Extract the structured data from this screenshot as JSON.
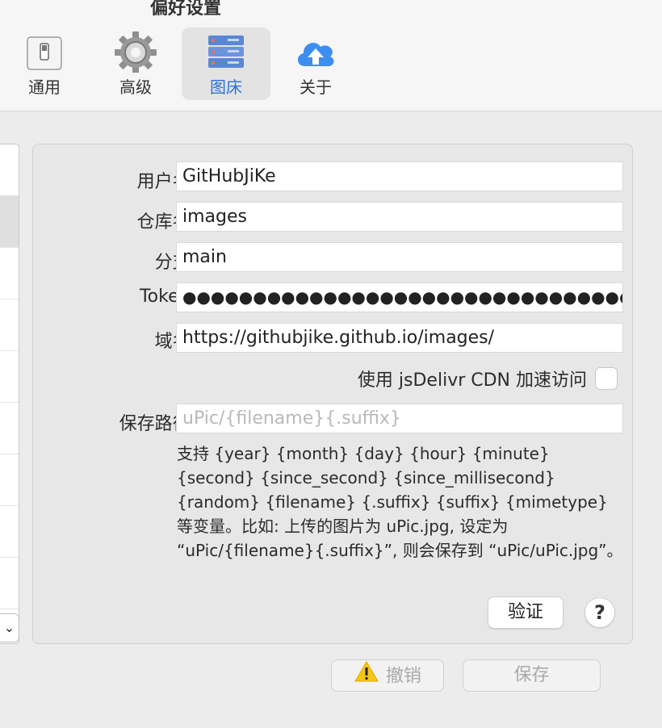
{
  "window": {
    "title": "偏好设置"
  },
  "toolbar": {
    "items": [
      {
        "label": "通用",
        "icon": "switch-icon"
      },
      {
        "label": "高级",
        "icon": "gear-icon"
      },
      {
        "label": "图床",
        "icon": "server-icon",
        "active": true
      },
      {
        "label": "关于",
        "icon": "cloud-upload-icon"
      }
    ]
  },
  "form": {
    "username": {
      "label": "用户名:",
      "value": "GitHubJiKe"
    },
    "repo": {
      "label": "仓库名:",
      "value": "images"
    },
    "branch": {
      "label": "分支:",
      "value": "main"
    },
    "token": {
      "label": "Token:",
      "value": "●●●●●●●●●●●●●●●●●●●●●●●●●●●●●●●●●●●..."
    },
    "domain": {
      "label": "域名:",
      "value": "https://githubjike.github.io/images/"
    },
    "cdn": {
      "label": "使用 jsDelivr CDN 加速访问",
      "checked": false
    },
    "save_path": {
      "label": "保存路径:",
      "placeholder": "uPic/{filename}{.suffix}"
    },
    "help": "支持 {year} {month} {day} {hour} {minute} {second} {since_second} {since_millisecond} {random} {filename} {.suffix} {suffix} {mimetype} 等变量。比如: 上传的图片为 uPic.jpg, 设定为 “uPic/{filename}{.suffix}”, 则会保存到 “uPic/uPic.jpg”。",
    "verify_label": "验证",
    "help_button": "?"
  },
  "footer": {
    "revert_label": "撤销",
    "save_label": "保存"
  },
  "colors": {
    "accent": "#2a73d9",
    "warning": "#f5c518"
  }
}
